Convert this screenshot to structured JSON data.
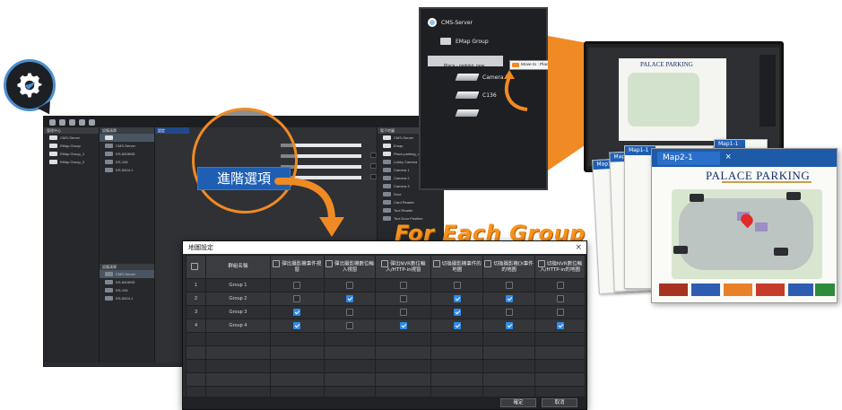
{
  "app": {
    "left_panel_title": "管理中心",
    "mid_panel_title": "設備清單",
    "content_tab": "設定",
    "right_panel_title": "電子地圖",
    "tree_left": [
      "CMS-Server",
      "EMap Group",
      "EMap Group_1",
      "EMap Group_2"
    ],
    "tree_mid": [
      "CMS-Server",
      "DS-6008HD",
      "DS-106",
      "DS-5004-1"
    ],
    "tree_mid2": [
      "CMS-Server",
      "DS-6008HD",
      "DS-106",
      "DS-5004-1"
    ],
    "tree_right": [
      "CMS-Server",
      "Emap",
      "Place-parking_new",
      "Lobby Camera",
      "Camera 1",
      "Camera 2",
      "Camera 3",
      "Door",
      "Card Reader",
      "Tool Reader",
      "Tool Door Position"
    ],
    "form_buttons": [
      "瀏覽",
      "瀏覽",
      "瀏覽"
    ]
  },
  "callout": {
    "advanced_button": "進階選項",
    "for_each_group": "For Each Group"
  },
  "dialog": {
    "title": "地圖設定",
    "close": "×",
    "headers": [
      "",
      "群組名稱",
      "彈出攝影機事件視窗",
      "彈出攝影機數位輸入視窗",
      "彈出NVR數位輸入/HTTP-in視窗",
      "切換攝影機事件的地圖",
      "切換攝影機DI事件的地圖",
      "切換NVR數位輸入/HTTP-in的地圖"
    ],
    "rows": [
      {
        "index": "1",
        "name": "Group 1",
        "checks": [
          false,
          false,
          false,
          false,
          false,
          false
        ]
      },
      {
        "index": "2",
        "name": "Group 2",
        "checks": [
          false,
          true,
          false,
          true,
          true,
          false
        ]
      },
      {
        "index": "3",
        "name": "Group 3",
        "checks": [
          true,
          false,
          false,
          true,
          false,
          false
        ]
      },
      {
        "index": "4",
        "name": "Group 4",
        "checks": [
          true,
          false,
          true,
          true,
          true,
          true
        ]
      }
    ],
    "empty_rows": 5,
    "ok_label": "確定",
    "cancel_label": "取消"
  },
  "popup": {
    "server": "CMS-Server",
    "emap_group": "EMap Group",
    "place": "Place - parking_new",
    "camera2": "Camera 2",
    "c136": "C136",
    "move_to": "Move to : Place - parking_new"
  },
  "maps": {
    "tab_front": "Map2-1",
    "tab_back1": "Map1-1",
    "tab_back2": "Map1-1",
    "tab_back3": "Map2-1",
    "tab_back4": "Map1-1",
    "parking_title": "PALACE PARKING",
    "monitor_title": "PALACE PARKING"
  },
  "colors": {
    "accent_orange": "#f08a24",
    "accent_blue": "#2f8be6",
    "dialog_bg": "#2a2c30"
  },
  "icons": {
    "gear": "gear-icon",
    "server": "server-icon",
    "camera": "camera-icon",
    "folder": "folder-icon"
  }
}
